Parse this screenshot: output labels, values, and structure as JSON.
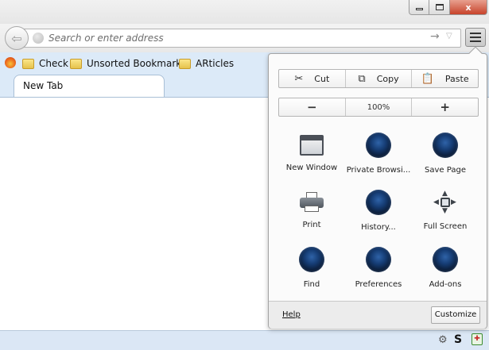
{
  "window": {
    "minimize_glyph": "",
    "maximize_glyph": "",
    "close_glyph": "x"
  },
  "navbar": {
    "back_glyph": "⇦",
    "address_placeholder": "Search or enter address",
    "go_glyph": "→",
    "dropmarker_glyph": "▽"
  },
  "bookmarks": [
    {
      "label": "Check"
    },
    {
      "label": "Unsorted Bookmarks"
    },
    {
      "label": "ARticles"
    }
  ],
  "tabs": [
    {
      "label": "New Tab"
    }
  ],
  "menu_panel": {
    "edit": {
      "cut_label": "Cut",
      "copy_label": "Copy",
      "paste_label": "Paste",
      "cut_icon": "✂",
      "copy_icon": "⧉",
      "paste_icon": "📋"
    },
    "zoom": {
      "out_label": "−",
      "reset_label": "100%",
      "in_label": "+"
    },
    "items": [
      {
        "label": "New Window",
        "icon": "new-window-icon"
      },
      {
        "label": "Private Browsi...",
        "icon": "private-browsing-icon"
      },
      {
        "label": "Save Page",
        "icon": "save-page-icon"
      },
      {
        "label": "Print",
        "icon": "print-icon"
      },
      {
        "label": "History...",
        "icon": "history-icon"
      },
      {
        "label": "Full Screen",
        "icon": "fullscreen-icon"
      },
      {
        "label": "Find",
        "icon": "find-icon"
      },
      {
        "label": "Preferences",
        "icon": "preferences-icon"
      },
      {
        "label": "Add-ons",
        "icon": "addons-icon"
      }
    ],
    "footer": {
      "help_label": "Help",
      "customize_label": "Customize"
    }
  },
  "statusbar": {
    "addon_2_glyph": "S",
    "addon_3_glyph": "✚"
  }
}
